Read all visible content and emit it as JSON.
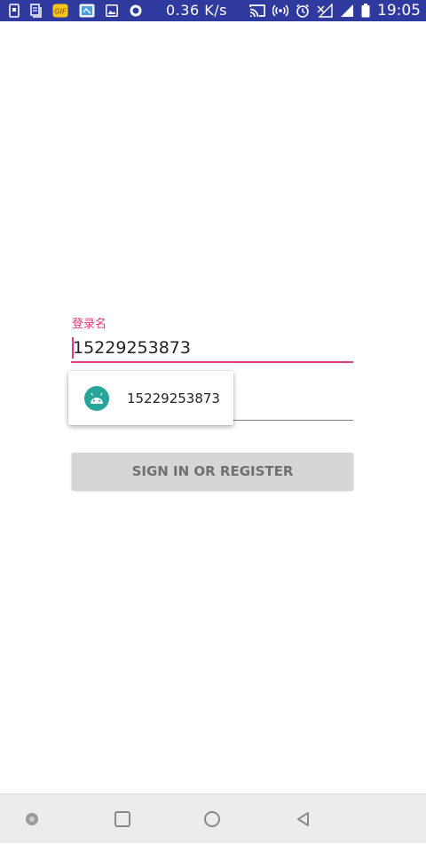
{
  "status_bar": {
    "speed": "0.36 K/s",
    "time": "19:05",
    "left_icons": [
      "sim-card-icon",
      "document-icon",
      "gif-icon",
      "app-icon",
      "image-icon",
      "circle-icon"
    ],
    "right_icons": [
      "cast-icon",
      "hotspot-icon",
      "alarm-icon",
      "signal-off-icon",
      "signal-icon",
      "battery-icon"
    ],
    "color": "#2f3a9e"
  },
  "form": {
    "login_label": "登录名",
    "login_value": "15229253873",
    "accent_color": "#e23a7f"
  },
  "autocomplete": {
    "suggestion": "15229253873",
    "icon": "android-icon",
    "icon_color": "#26a69a"
  },
  "button": {
    "label": "SIGN IN OR REGISTER"
  },
  "nav_bar": {
    "buttons": [
      "dot-icon",
      "recents-icon",
      "home-icon",
      "back-icon"
    ]
  }
}
